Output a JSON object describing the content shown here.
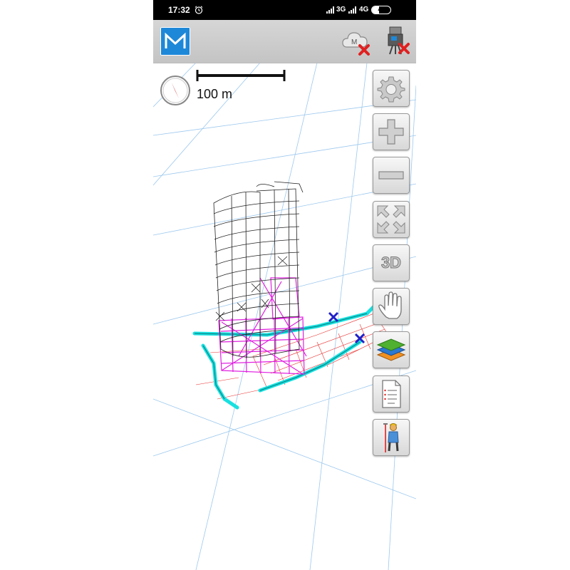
{
  "status_bar": {
    "time": "17:32",
    "network_1": "3G",
    "network_2": "4G",
    "battery": "40"
  },
  "toolbar": {
    "logo_letter": "M"
  },
  "map": {
    "scale_label": "100 m"
  },
  "side_buttons": {
    "view_mode_label": "3D"
  },
  "icons": [
    "alarm-clock-icon",
    "signal-icon",
    "battery-icon",
    "app-logo-m",
    "cloud-disconnected-icon",
    "total-station-disconnected-icon",
    "compass-icon",
    "gear-icon",
    "plus-icon",
    "minus-icon",
    "expand-arrows-icon",
    "hand-icon",
    "layers-icon",
    "document-icon",
    "surveyor-icon"
  ],
  "colors": {
    "accent": "#1e88d8",
    "disconnect_red": "#e02020",
    "cyan_lines": "#19e0e0",
    "magenta_lines": "#e020e0",
    "red_mesh": "#e83030",
    "grid": "#9cc8ee"
  }
}
